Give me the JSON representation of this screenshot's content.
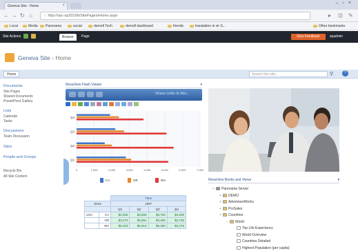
{
  "browser": {
    "tab_title": "Geneva Site - Home",
    "url": "http://vpc-sp2010b/SitePages/Home.aspx",
    "bookmarks": [
      "Local",
      "Media",
      "Panorama",
      "social",
      "dornell Tech",
      "dornell dashboard",
      "friends",
      "translation in vir S...",
      "Other bookmarks"
    ]
  },
  "ribbon": {
    "site_actions": "Site Actions",
    "tabs": [
      "Browse",
      "Page"
    ],
    "feedback": "Give Feedback",
    "user": "spadmin"
  },
  "site": {
    "title": "Geneva Site",
    "separator": "›",
    "page": "Home",
    "home_tab": "Home",
    "search_placeholder": "Search this site..."
  },
  "quick_launch": {
    "items": [
      {
        "label": "Documents",
        "kind": "heading"
      },
      {
        "label": "Site Pages",
        "kind": "sub"
      },
      {
        "label": "Shared Documents",
        "kind": "sub"
      },
      {
        "label": "PowerPivot Gallery",
        "kind": "sub"
      },
      {
        "label": "Lists",
        "kind": "heading"
      },
      {
        "label": "Calendar",
        "kind": "sub"
      },
      {
        "label": "Tasks",
        "kind": "sub"
      },
      {
        "label": "Discussions",
        "kind": "heading"
      },
      {
        "label": "Team Discussion",
        "kind": "sub"
      },
      {
        "label": "Sites",
        "kind": "heading"
      },
      {
        "label": "People and Groups",
        "kind": "heading"
      },
      {
        "label": "Recycle Bin",
        "kind": "sub"
      },
      {
        "label": "All Site Content",
        "kind": "sub"
      }
    ]
  },
  "viewer": {
    "title": "NovaView Flash Viewer",
    "link": "Share Links to this...",
    "chart_data": {
      "type": "bar",
      "orientation": "horizontal",
      "categories": [
        "Q4",
        "Q3",
        "Q2",
        "Q1"
      ],
      "series": [
        {
          "name": "CA",
          "color": "#3f74c9",
          "values": [
            1900,
            2200,
            1600,
            2800
          ]
        },
        {
          "name": "OR",
          "color": "#e48a2a",
          "values": [
            2400,
            2700,
            2000,
            3100
          ]
        },
        {
          "name": "WA",
          "color": "#e03838",
          "values": [
            3800,
            5100,
            5500,
            5200
          ]
        }
      ],
      "xlim": [
        0,
        7000
      ],
      "xticks": [
        "0",
        "1,000",
        "2,000",
        "3,000",
        "4,000",
        "5,000",
        "6,000",
        "7,000"
      ]
    }
  },
  "pivot": {
    "header": "Time",
    "year": "1997",
    "measure_label": "Store",
    "quarters": [
      "Q1",
      "Q2",
      "Q3",
      "Q4"
    ],
    "rows": [
      {
        "group": "USA",
        "state": "CA",
        "values": [
          "$3,026",
          "$3,555",
          "$3,784",
          "$4,030"
        ]
      },
      {
        "group": "",
        "state": "OR",
        "values": [
          "$3,270",
          "$3,561",
          "$3,300",
          "$3,730"
        ]
      },
      {
        "group": "",
        "state": "WA",
        "values": [
          "$6,323",
          "$6,613",
          "$5,460",
          "$3,276"
        ]
      }
    ]
  },
  "tree": {
    "title": "NovaView Books and Views",
    "nodes": [
      {
        "label": "Panorama Server",
        "depth": 0,
        "type": "server"
      },
      {
        "label": "DEMO",
        "depth": 1,
        "type": "folder"
      },
      {
        "label": "AdventureWorks",
        "depth": 1,
        "type": "folder"
      },
      {
        "label": "ProSales",
        "depth": 1,
        "type": "folder"
      },
      {
        "label": "Countries",
        "depth": 1,
        "type": "folder"
      },
      {
        "label": "World",
        "depth": 2,
        "type": "folder"
      },
      {
        "label": "Top Life Expectancy",
        "depth": 3,
        "type": "doc"
      },
      {
        "label": "World Overview",
        "depth": 3,
        "type": "doc"
      },
      {
        "label": "Countries Detailed",
        "depth": 3,
        "type": "doc"
      },
      {
        "label": "Highest Population (per capita)",
        "depth": 3,
        "type": "doc"
      }
    ]
  }
}
